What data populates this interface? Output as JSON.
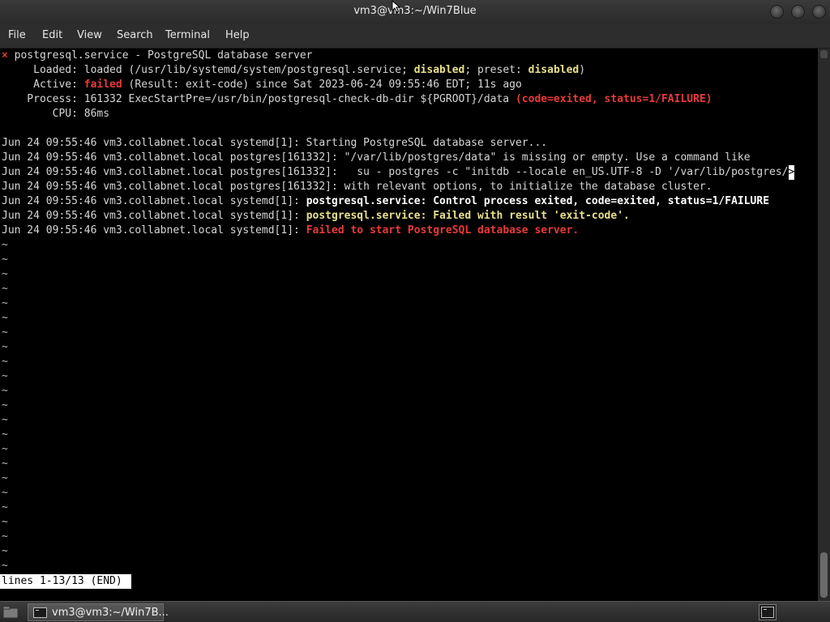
{
  "window": {
    "title": "vm3@vm3:~/Win7Blue"
  },
  "menu": {
    "items": [
      "File",
      "Edit",
      "View",
      "Search",
      "Terminal",
      "Help"
    ]
  },
  "status": {
    "bullet": "×",
    "line1": "postgresql.service - PostgreSQL database server",
    "loaded_prefix": "     Loaded: loaded (/usr/lib/systemd/system/postgresql.service; ",
    "loaded_disabled": "disabled",
    "loaded_mid": "; preset: ",
    "loaded_preset": "disabled",
    "loaded_suffix": ")",
    "active_prefix": "     Active: ",
    "active_state": "failed",
    "active_suffix": " (Result: exit-code) since Sat 2023-06-24 09:55:46 EDT; 11s ago",
    "process_prefix": "    Process: 161332 ExecStartPre=/usr/bin/postgresql-check-db-dir ${PGROOT}/data ",
    "process_result": "(code=exited, status=1/FAILURE)",
    "cpu": "        CPU: 86ms"
  },
  "journal": {
    "l1": "Jun 24 09:55:46 vm3.collabnet.local systemd[1]: Starting PostgreSQL database server...",
    "l2": "Jun 24 09:55:46 vm3.collabnet.local postgres[161332]: \"/var/lib/postgres/data\" is missing or empty. Use a command like",
    "l3": "Jun 24 09:55:46 vm3.collabnet.local postgres[161332]:   su - postgres -c \"initdb --locale en_US.UTF-8 -D '/var/lib/postgres/",
    "l3_arrow": ">",
    "l4": "Jun 24 09:55:46 vm3.collabnet.local postgres[161332]: with relevant options, to initialize the database cluster.",
    "l5_prefix": "Jun 24 09:55:46 vm3.collabnet.local systemd[1]: ",
    "l5_msg": "postgresql.service: Control process exited, code=exited, status=1/FAILURE",
    "l6_prefix": "Jun 24 09:55:46 vm3.collabnet.local systemd[1]: ",
    "l6_msg": "postgresql.service: Failed with result 'exit-code'.",
    "l7_prefix": "Jun 24 09:55:46 vm3.collabnet.local systemd[1]: ",
    "l7_msg": "Failed to start PostgreSQL database server."
  },
  "pager": {
    "tilde": "~",
    "tilde_count": 23,
    "status": "lines 1-13/13 (END)"
  },
  "taskbar": {
    "task_label": "vm3@vm3:~/Win7B..."
  },
  "colors": {
    "error_red": "#e83a3a",
    "warning_yellow": "#e8e08a",
    "terminal_bg": "#000000",
    "terminal_fg": "#d6d6d6"
  }
}
